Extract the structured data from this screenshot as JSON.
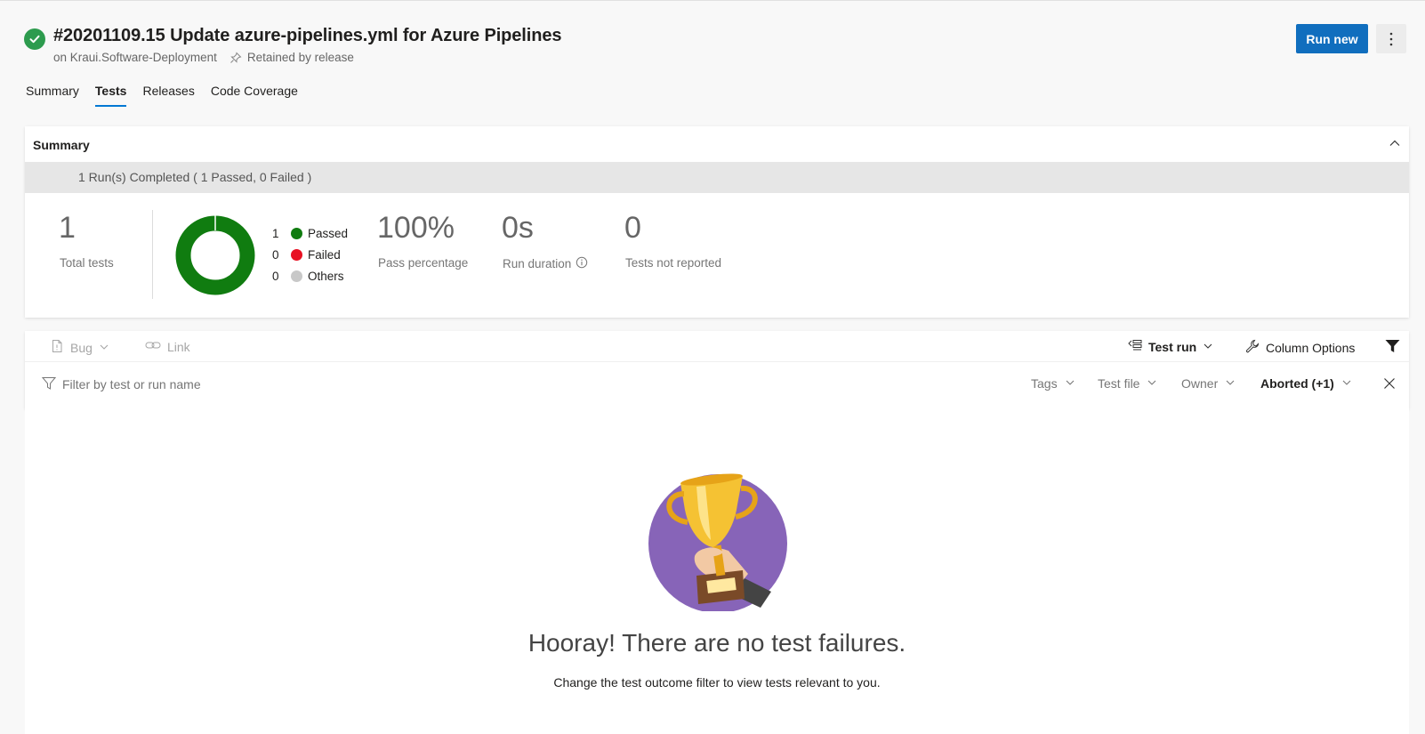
{
  "header": {
    "title": "#20201109.15 Update azure-pipelines.yml for Azure Pipelines",
    "branch_text": "on Kraui.Software-Deployment",
    "retained_text": "Retained by release",
    "run_new_label": "Run new",
    "status": "succeeded"
  },
  "tabs": [
    {
      "label": "Summary",
      "active": false
    },
    {
      "label": "Tests",
      "active": true
    },
    {
      "label": "Releases",
      "active": false
    },
    {
      "label": "Code Coverage",
      "active": false
    }
  ],
  "summary": {
    "title": "Summary",
    "run_status": "1 Run(s) Completed ( 1 Passed, 0 Failed )",
    "total_tests": "1",
    "total_tests_label": "Total tests",
    "legend": [
      {
        "count": "1",
        "label": "Passed",
        "color": "#107c10"
      },
      {
        "count": "0",
        "label": "Failed",
        "color": "#e81123"
      },
      {
        "count": "0",
        "label": "Others",
        "color": "#c8c8c8"
      }
    ],
    "pass_percentage": "100%",
    "pass_percentage_label": "Pass percentage",
    "run_duration": "0s",
    "run_duration_label": "Run duration",
    "not_reported": "0",
    "not_reported_label": "Tests not reported"
  },
  "toolbar": {
    "bug_label": "Bug",
    "link_label": "Link",
    "group_by_label": "Test run",
    "column_options_label": "Column Options"
  },
  "filter_bar": {
    "placeholder": "Filter by test or run name",
    "filters": [
      {
        "label": "Tags",
        "active": false
      },
      {
        "label": "Test file",
        "active": false
      },
      {
        "label": "Owner",
        "active": false
      },
      {
        "label": "Aborted (+1)",
        "active": true
      }
    ]
  },
  "empty_state": {
    "heading": "Hooray! There are no test failures.",
    "subtext": "Change the test outcome filter to view tests relevant to you."
  },
  "colors": {
    "accent": "#0078d4",
    "primary_button": "#106ebe",
    "success": "#107c10",
    "trophy_circle": "#8764b8"
  }
}
